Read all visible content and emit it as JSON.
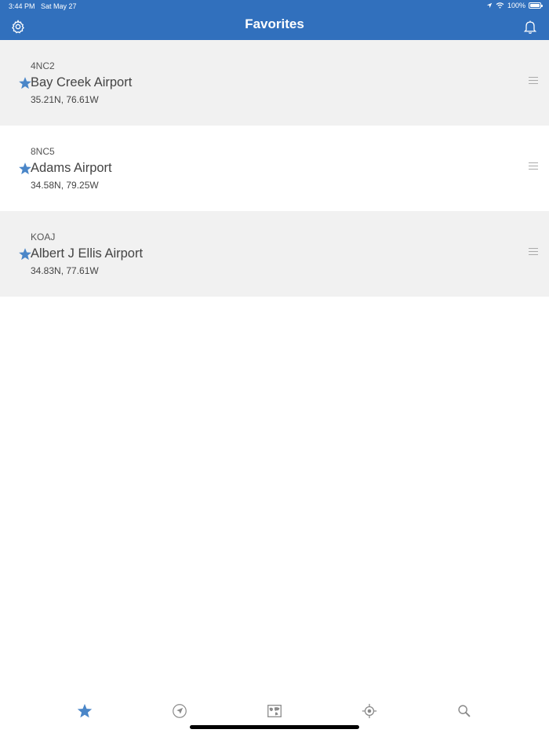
{
  "status_bar": {
    "time": "3:44 PM",
    "date": "Sat May 27",
    "battery": "100%",
    "icons": [
      "location-arrow-icon",
      "wifi-icon",
      "battery-icon"
    ]
  },
  "header": {
    "title": "Favorites",
    "left_icon": "settings-gear-icon",
    "right_icon": "bell-icon",
    "background_color": "#3170bd"
  },
  "favorites": [
    {
      "code": "4NC2",
      "name": "Bay Creek Airport",
      "coords": "35.21N, 76.61W"
    },
    {
      "code": "8NC5",
      "name": "Adams Airport",
      "coords": "34.58N, 79.25W"
    },
    {
      "code": "KOAJ",
      "name": "Albert J Ellis Airport",
      "coords": "34.83N, 77.61W"
    }
  ],
  "tab_bar": {
    "tabs": [
      {
        "icon": "favorites-star-icon",
        "selected": true
      },
      {
        "icon": "nearby-navigation-icon",
        "selected": false
      },
      {
        "icon": "map-icon",
        "selected": false
      },
      {
        "icon": "location-target-icon",
        "selected": false
      },
      {
        "icon": "search-icon",
        "selected": false
      }
    ],
    "selected_color": "#4a86c8",
    "unselected_color": "#8a8a8a"
  }
}
